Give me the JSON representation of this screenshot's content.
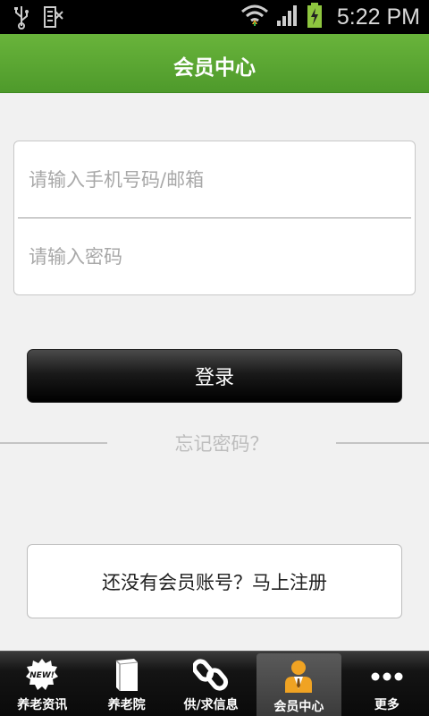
{
  "status_bar": {
    "time": "5:22 PM",
    "icons": [
      "usb-icon",
      "sim-icon",
      "wifi-icon",
      "signal-icon",
      "battery-charging-icon"
    ]
  },
  "header": {
    "title": "会员中心"
  },
  "login": {
    "username_placeholder": "请输入手机号码/邮箱",
    "password_placeholder": "请输入密码",
    "submit_label": "登录",
    "forgot_label": "忘记密码？",
    "register_label": "还没有会员账号？马上注册"
  },
  "tabs": [
    {
      "label": "养老资讯",
      "icon": "news-badge-icon",
      "active": false
    },
    {
      "label": "养老院",
      "icon": "book-icon",
      "active": false
    },
    {
      "label": "供/求信息",
      "icon": "link-icon",
      "active": false
    },
    {
      "label": "会员中心",
      "icon": "member-icon",
      "active": true
    },
    {
      "label": "更多",
      "icon": "more-dots-icon",
      "active": false
    }
  ],
  "colors": {
    "header_green": "#5aa832",
    "active_tab_bg": "#4a4a4a",
    "member_icon": "#f0a323"
  }
}
